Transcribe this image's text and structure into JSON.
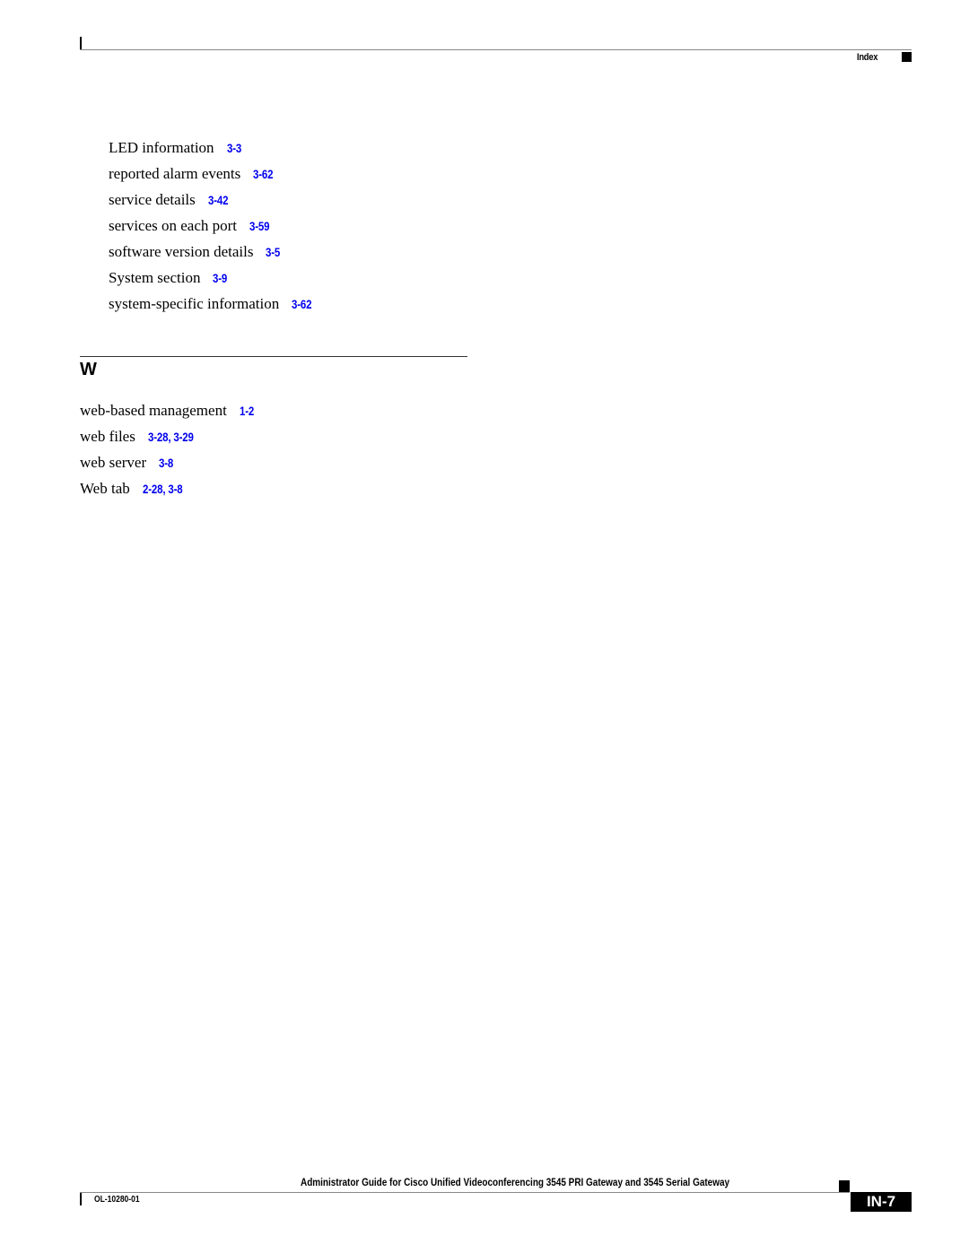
{
  "header": {
    "section_label": "Index"
  },
  "continued_entries": [
    {
      "term": "LED information",
      "pages": "3-3"
    },
    {
      "term": "reported alarm events",
      "pages": "3-62"
    },
    {
      "term": "service details",
      "pages": "3-42"
    },
    {
      "term": "services on each port",
      "pages": "3-59"
    },
    {
      "term": "software version details",
      "pages": "3-5"
    },
    {
      "term": "System section",
      "pages": "3-9"
    },
    {
      "term": "system-specific information",
      "pages": "3-62"
    }
  ],
  "section_w": {
    "letter": "W",
    "entries": [
      {
        "term": "web-based management",
        "pages": "1-2"
      },
      {
        "term": "web files",
        "pages": "3-28, 3-29"
      },
      {
        "term": "web server",
        "pages": "3-8"
      },
      {
        "term": "Web tab",
        "pages": "2-28, 3-8"
      }
    ]
  },
  "footer": {
    "book_title": "Administrator Guide for Cisco Unified Videoconferencing 3545 PRI Gateway and 3545 Serial Gateway",
    "doc_number": "OL-10280-01",
    "page_number": "IN-7"
  }
}
